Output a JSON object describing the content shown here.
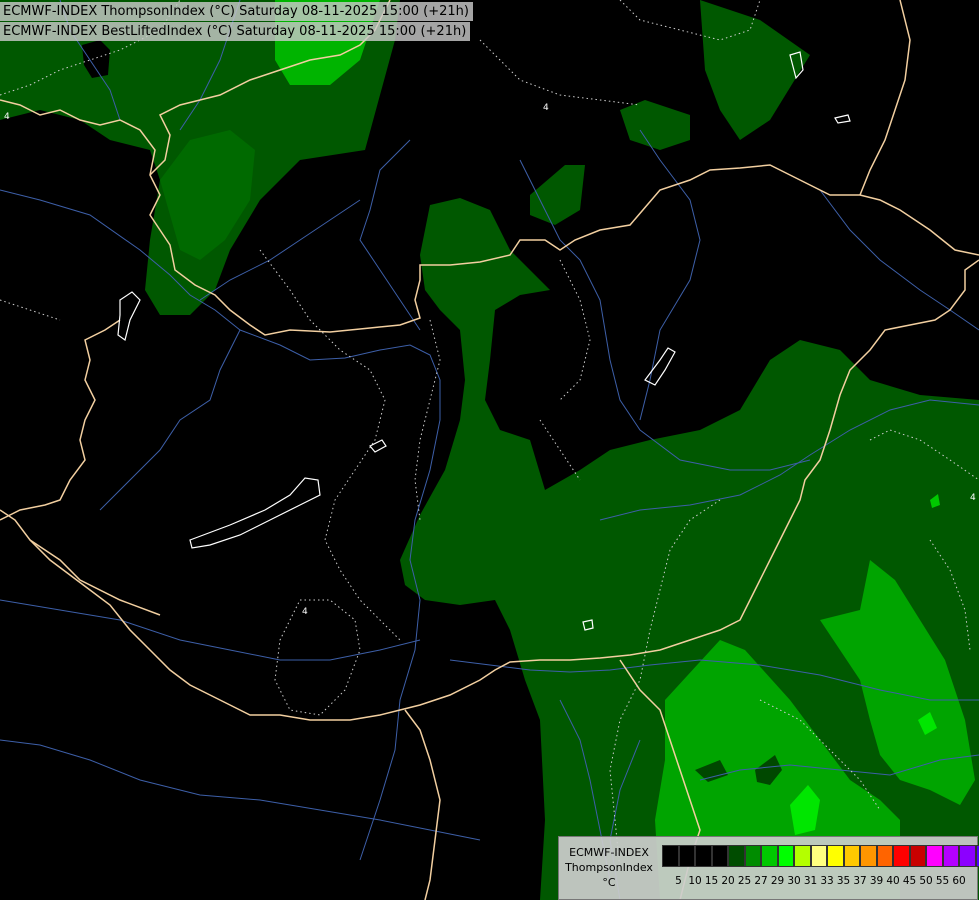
{
  "titles": {
    "line1": "ECMWF-INDEX ThompsonIndex (°C) Saturday 08-11-2025 15:00 (+21h)",
    "line2": "ECMWF-INDEX BestLiftedIndex (°C) Saturday 08-11-2025 15:00 (+21h)"
  },
  "map": {
    "contour_labels": [
      "4",
      "4",
      "4",
      "4"
    ]
  },
  "legend": {
    "label_line1": "ECMWF-INDEX",
    "label_line2": "ThompsonIndex",
    "label_line3": "°C",
    "ticks": [
      "5",
      "10",
      "15",
      "20",
      "25",
      "27",
      "29",
      "30",
      "31",
      "33",
      "35",
      "37",
      "39",
      "40",
      "45",
      "50",
      "55",
      "60"
    ],
    "colors": [
      "#000000",
      "#000000",
      "#000000",
      "#000000",
      "#004c00",
      "#008c00",
      "#00c800",
      "#00ff00",
      "#b4ff00",
      "#ffff80",
      "#ffff00",
      "#ffc800",
      "#ff9600",
      "#ff6400",
      "#ff0000",
      "#c80000",
      "#ff00ff",
      "#b400ff",
      "#8c00ff",
      "#5000ff",
      "#0000ff"
    ]
  }
}
